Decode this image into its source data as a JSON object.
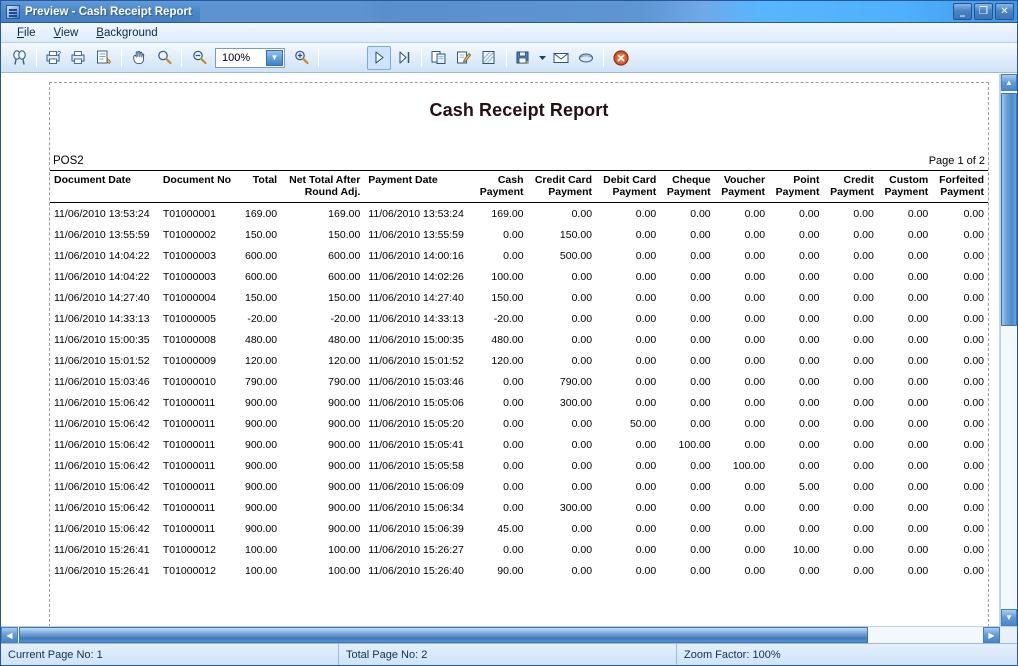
{
  "window": {
    "title": "Preview - Cash Receipt Report",
    "app_icon": "report-preview-icon",
    "controls": {
      "minimize": "_",
      "maximize": "❐",
      "close": "✕"
    }
  },
  "menu": {
    "items": [
      {
        "label": "File",
        "name": "menu-file"
      },
      {
        "label": "View",
        "name": "menu-view"
      },
      {
        "label": "Background",
        "name": "menu-background"
      }
    ]
  },
  "toolbar": {
    "zoom_value": "100%",
    "buttons": [
      {
        "name": "search-icon",
        "title": "Search"
      },
      {
        "name": "print-preview-icon",
        "title": "Print Preview"
      },
      {
        "name": "print-icon",
        "title": "Print"
      },
      {
        "name": "page-setup-icon",
        "title": "Page Setup"
      },
      {
        "name": "hand-pan-icon",
        "title": "Pan"
      },
      {
        "name": "zoom-tool-icon",
        "title": "Zoom"
      },
      {
        "name": "zoom-out-icon",
        "title": "Zoom Out"
      },
      {
        "name": "zoom-in-icon",
        "title": "Zoom In"
      },
      {
        "name": "next-page-icon",
        "title": "Next Page"
      },
      {
        "name": "last-page-icon",
        "title": "Last Page"
      },
      {
        "name": "page-layout-icon",
        "title": "Page Layout"
      },
      {
        "name": "annotate-icon",
        "title": "Annotate"
      },
      {
        "name": "watermark-icon",
        "title": "Watermark"
      },
      {
        "name": "export-icon",
        "title": "Export"
      },
      {
        "name": "email-icon",
        "title": "Email"
      },
      {
        "name": "publish-icon",
        "title": "Publish"
      },
      {
        "name": "close-report-icon",
        "title": "Close"
      }
    ]
  },
  "report": {
    "title": "Cash Receipt Report",
    "location": "POS2",
    "page_of": "Page 1 of 2",
    "columns": [
      {
        "label": "Document Date",
        "align": "l"
      },
      {
        "label": "Document No",
        "align": "l"
      },
      {
        "label": "Total",
        "align": "r"
      },
      {
        "label": "Net Total After\nRound Adj.",
        "align": "r"
      },
      {
        "label": "Payment Date",
        "align": "l"
      },
      {
        "label": "Cash\nPayment",
        "align": "r"
      },
      {
        "label": "Credit Card\nPayment",
        "align": "r"
      },
      {
        "label": "Debit Card\nPayment",
        "align": "r"
      },
      {
        "label": "Cheque\nPayment",
        "align": "r"
      },
      {
        "label": "Voucher\nPayment",
        "align": "r"
      },
      {
        "label": "Point\nPayment",
        "align": "r"
      },
      {
        "label": "Credit\nPayment",
        "align": "r"
      },
      {
        "label": "Custom\nPayment",
        "align": "r"
      },
      {
        "label": "Forfeited\nPayment",
        "align": "r"
      }
    ],
    "rows": [
      [
        "11/06/2010 13:53:24",
        "T01000001",
        "169.00",
        "169.00",
        "11/06/2010 13:53:24",
        "169.00",
        "0.00",
        "0.00",
        "0.00",
        "0.00",
        "0.00",
        "0.00",
        "0.00",
        "0.00"
      ],
      [
        "11/06/2010 13:55:59",
        "T01000002",
        "150.00",
        "150.00",
        "11/06/2010 13:55:59",
        "0.00",
        "150.00",
        "0.00",
        "0.00",
        "0.00",
        "0.00",
        "0.00",
        "0.00",
        "0.00"
      ],
      [
        "11/06/2010 14:04:22",
        "T01000003",
        "600.00",
        "600.00",
        "11/06/2010 14:00:16",
        "0.00",
        "500.00",
        "0.00",
        "0.00",
        "0.00",
        "0.00",
        "0.00",
        "0.00",
        "0.00"
      ],
      [
        "11/06/2010 14:04:22",
        "T01000003",
        "600.00",
        "600.00",
        "11/06/2010 14:02:26",
        "100.00",
        "0.00",
        "0.00",
        "0.00",
        "0.00",
        "0.00",
        "0.00",
        "0.00",
        "0.00"
      ],
      [
        "11/06/2010 14:27:40",
        "T01000004",
        "150.00",
        "150.00",
        "11/06/2010 14:27:40",
        "150.00",
        "0.00",
        "0.00",
        "0.00",
        "0.00",
        "0.00",
        "0.00",
        "0.00",
        "0.00"
      ],
      [
        "11/06/2010 14:33:13",
        "T01000005",
        "-20.00",
        "-20.00",
        "11/06/2010 14:33:13",
        "-20.00",
        "0.00",
        "0.00",
        "0.00",
        "0.00",
        "0.00",
        "0.00",
        "0.00",
        "0.00"
      ],
      [
        "11/06/2010 15:00:35",
        "T01000008",
        "480.00",
        "480.00",
        "11/06/2010 15:00:35",
        "480.00",
        "0.00",
        "0.00",
        "0.00",
        "0.00",
        "0.00",
        "0.00",
        "0.00",
        "0.00"
      ],
      [
        "11/06/2010 15:01:52",
        "T01000009",
        "120.00",
        "120.00",
        "11/06/2010 15:01:52",
        "120.00",
        "0.00",
        "0.00",
        "0.00",
        "0.00",
        "0.00",
        "0.00",
        "0.00",
        "0.00"
      ],
      [
        "11/06/2010 15:03:46",
        "T01000010",
        "790.00",
        "790.00",
        "11/06/2010 15:03:46",
        "0.00",
        "790.00",
        "0.00",
        "0.00",
        "0.00",
        "0.00",
        "0.00",
        "0.00",
        "0.00"
      ],
      [
        "11/06/2010 15:06:42",
        "T01000011",
        "900.00",
        "900.00",
        "11/06/2010 15:05:06",
        "0.00",
        "300.00",
        "0.00",
        "0.00",
        "0.00",
        "0.00",
        "0.00",
        "0.00",
        "0.00"
      ],
      [
        "11/06/2010 15:06:42",
        "T01000011",
        "900.00",
        "900.00",
        "11/06/2010 15:05:20",
        "0.00",
        "0.00",
        "50.00",
        "0.00",
        "0.00",
        "0.00",
        "0.00",
        "0.00",
        "0.00"
      ],
      [
        "11/06/2010 15:06:42",
        "T01000011",
        "900.00",
        "900.00",
        "11/06/2010 15:05:41",
        "0.00",
        "0.00",
        "0.00",
        "100.00",
        "0.00",
        "0.00",
        "0.00",
        "0.00",
        "0.00"
      ],
      [
        "11/06/2010 15:06:42",
        "T01000011",
        "900.00",
        "900.00",
        "11/06/2010 15:05:58",
        "0.00",
        "0.00",
        "0.00",
        "0.00",
        "100.00",
        "0.00",
        "0.00",
        "0.00",
        "0.00"
      ],
      [
        "11/06/2010 15:06:42",
        "T01000011",
        "900.00",
        "900.00",
        "11/06/2010 15:06:09",
        "0.00",
        "0.00",
        "0.00",
        "0.00",
        "0.00",
        "5.00",
        "0.00",
        "0.00",
        "0.00"
      ],
      [
        "11/06/2010 15:06:42",
        "T01000011",
        "900.00",
        "900.00",
        "11/06/2010 15:06:34",
        "0.00",
        "300.00",
        "0.00",
        "0.00",
        "0.00",
        "0.00",
        "0.00",
        "0.00",
        "0.00"
      ],
      [
        "11/06/2010 15:06:42",
        "T01000011",
        "900.00",
        "900.00",
        "11/06/2010 15:06:39",
        "45.00",
        "0.00",
        "0.00",
        "0.00",
        "0.00",
        "0.00",
        "0.00",
        "0.00",
        "0.00"
      ],
      [
        "11/06/2010 15:26:41",
        "T01000012",
        "100.00",
        "100.00",
        "11/06/2010 15:26:27",
        "0.00",
        "0.00",
        "0.00",
        "0.00",
        "0.00",
        "10.00",
        "0.00",
        "0.00",
        "0.00"
      ],
      [
        "11/06/2010 15:26:41",
        "T01000012",
        "100.00",
        "100.00",
        "11/06/2010 15:26:40",
        "90.00",
        "0.00",
        "0.00",
        "0.00",
        "0.00",
        "0.00",
        "0.00",
        "0.00",
        "0.00"
      ]
    ]
  },
  "status_bar": {
    "current_page": "Current Page No: 1",
    "total_page": "Total Page No: 2",
    "zoom_factor": "Zoom Factor: 100%"
  },
  "colors": {
    "title_bar": "#4d86c8",
    "accent": "#3f79be",
    "report_title": "#241012",
    "close_red": "#c0392b"
  }
}
